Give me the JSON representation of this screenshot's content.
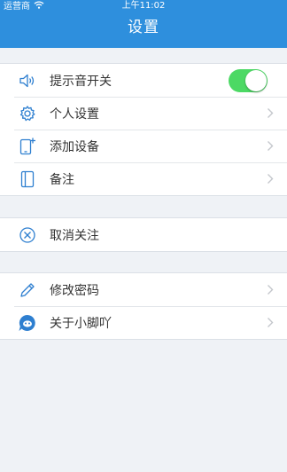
{
  "status_bar": {
    "carrier": "运营商",
    "time": "上午11:02"
  },
  "nav": {
    "title": "设置"
  },
  "colors": {
    "nav_background": "#2e8fdd",
    "toggle_on": "#4cd964",
    "page_background": "#eff2f6",
    "icon_blue": "#2e7fd0"
  },
  "sections": {
    "general": [
      {
        "label": "提示音开关",
        "icon": "speaker-icon",
        "toggle_on": true
      },
      {
        "label": "个人设置",
        "icon": "gear-icon"
      },
      {
        "label": "添加设备",
        "icon": "add-device-icon"
      },
      {
        "label": "备注",
        "icon": "note-icon"
      }
    ],
    "unfollow": [
      {
        "label": "取消关注",
        "icon": "cancel-circle-icon"
      }
    ],
    "account": [
      {
        "label": "修改密码",
        "icon": "pencil-icon"
      },
      {
        "label": "关于小脚吖",
        "icon": "app-logo-icon"
      }
    ]
  }
}
